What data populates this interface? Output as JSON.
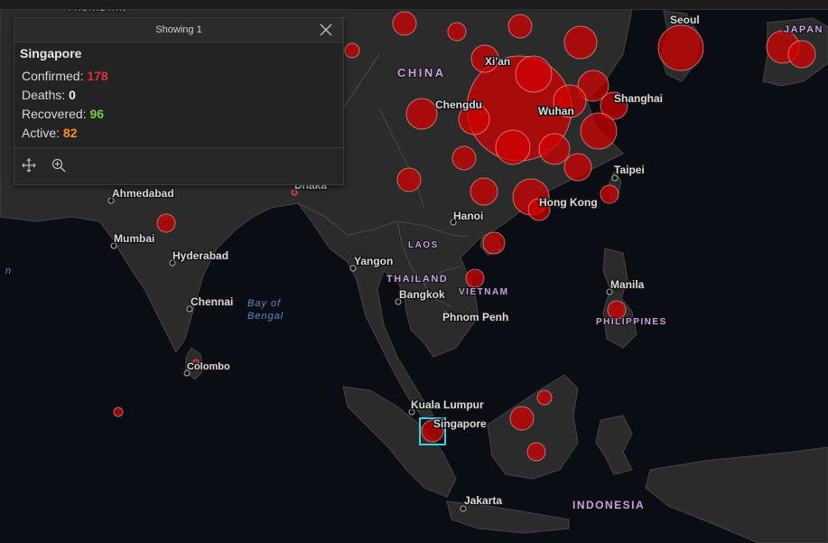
{
  "popup": {
    "count_label": "Showing 1",
    "title": "Singapore",
    "stats": [
      {
        "label": "Confirmed:",
        "value": "178",
        "color": "#e0303b"
      },
      {
        "label": "Deaths:",
        "value": "0",
        "color": "#f2f2f2"
      },
      {
        "label": "Recovered:",
        "value": "96",
        "color": "#6cd04a"
      },
      {
        "label": "Active:",
        "value": "82",
        "color": "#ff8a20"
      }
    ],
    "tools": [
      "move-icon",
      "zoom-to-icon"
    ],
    "close_icon": "close-icon"
  },
  "map": {
    "countries": [
      "CHINA",
      "JAPAN",
      "LAOS",
      "THAILAND",
      "VIETNAM",
      "PHILIPPINES",
      "INDONESIA"
    ],
    "cities": [
      "Seoul",
      "Xi'an",
      "Chengdu",
      "Wuhan",
      "Shanghai",
      "Taipei",
      "Hong Kong",
      "Hanoi",
      "Dhaka",
      "Ahmedabad",
      "Mumbai",
      "Hyderabad",
      "Chennai",
      "Colombo",
      "Yangon",
      "Bangkok",
      "Phnom Penh",
      "Manila",
      "Kuala Lumpur",
      "Singapore",
      "Jakarta"
    ],
    "seas": [
      "Bay of",
      "Bengal"
    ],
    "fragments": [
      "n",
      "FAUNISTAN"
    ],
    "selected": "Singapore",
    "colors": {
      "bubble": "#d60000",
      "land": "#2c2c2c",
      "water": "#0a0e14",
      "selection": "#3fd0e0"
    }
  }
}
